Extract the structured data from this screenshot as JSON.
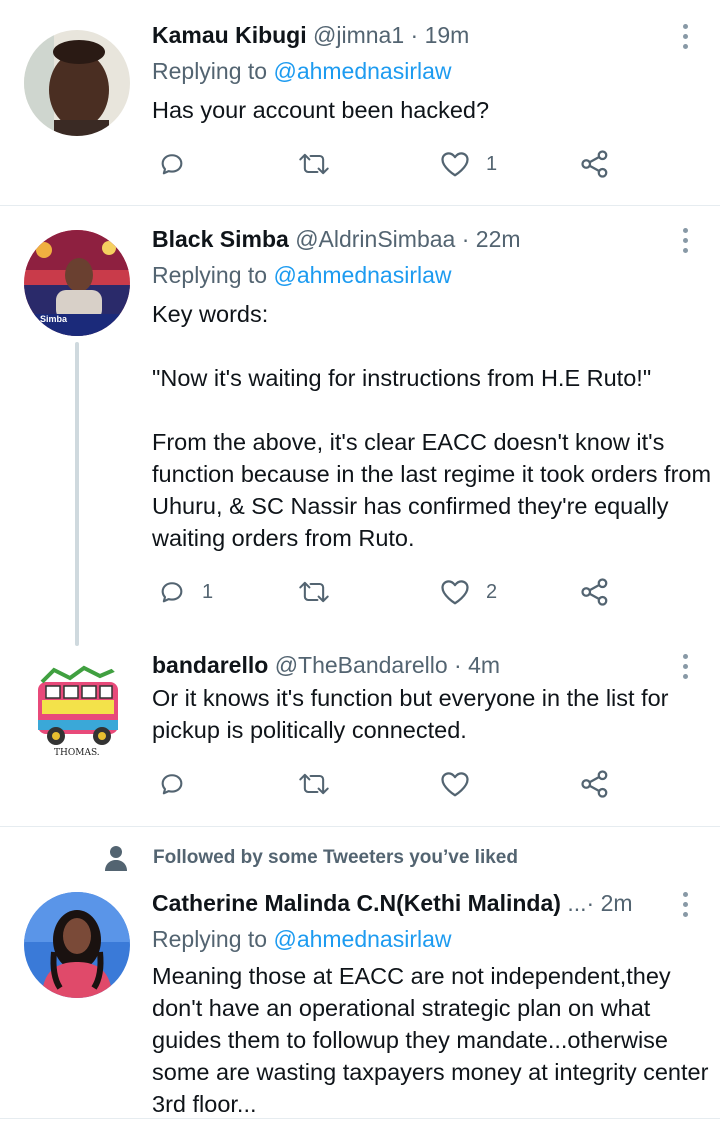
{
  "tweets": [
    {
      "name": "Kamau Kibugi",
      "handle": "@jimna1",
      "dot": "·",
      "time": "19m",
      "replying_prefix": "Replying to",
      "replying_to": "@ahmednasirlaw",
      "body": [
        "Has your account been hacked?"
      ],
      "reply_count": "",
      "retweet_count": "",
      "like_count": "1"
    },
    {
      "name": "Black Simba",
      "handle": "@AldrinSimbaa",
      "dot": "·",
      "time": "22m",
      "replying_prefix": "Replying to",
      "replying_to": "@ahmednasirlaw",
      "avatar_caption": "n Simba",
      "body": [
        "Key words:",
        "",
        "\"Now it's waiting for instructions from H.E Ruto!\"",
        "",
        "From the above, it's clear EACC doesn't know it's function because in the last regime it took orders from Uhuru, & SC Nassir has confirmed they're equally waiting orders from Ruto."
      ],
      "reply_count": "1",
      "retweet_count": "",
      "like_count": "2"
    },
    {
      "name": "bandarello",
      "handle": "@TheBandarello",
      "dot": "·",
      "time": "4m",
      "avatar_caption": "THOMAS.",
      "body": [
        "Or it knows it's function but everyone in the list for pickup is politically connected."
      ],
      "reply_count": "",
      "retweet_count": "",
      "like_count": ""
    },
    {
      "name": "Catherine Malinda C.N(Kethi Malinda)",
      "ellipsis": "...",
      "dot": "·",
      "time": "2m",
      "replying_prefix": "Replying to",
      "replying_to": "@ahmednasirlaw",
      "body": [
        "Meaning those at EACC are not independent,they don't have an operational strategic plan on what guides them to followup they mandate...otherwise some are wasting taxpayers money at integrity center 3rd floor..."
      ]
    }
  ],
  "followed_banner": "Followed by some Tweeters you’ve liked",
  "icons": {
    "reply": "reply-icon",
    "retweet": "retweet-icon",
    "like": "like-icon",
    "share": "share-icon",
    "more": "more-options-icon",
    "person": "person-icon"
  },
  "colors": {
    "text": "#0f1419",
    "secondary": "#536471",
    "link": "#1d9bf0",
    "icon": "#536471",
    "divider": "#e6ecf0",
    "thread_line": "#cfd9de"
  }
}
